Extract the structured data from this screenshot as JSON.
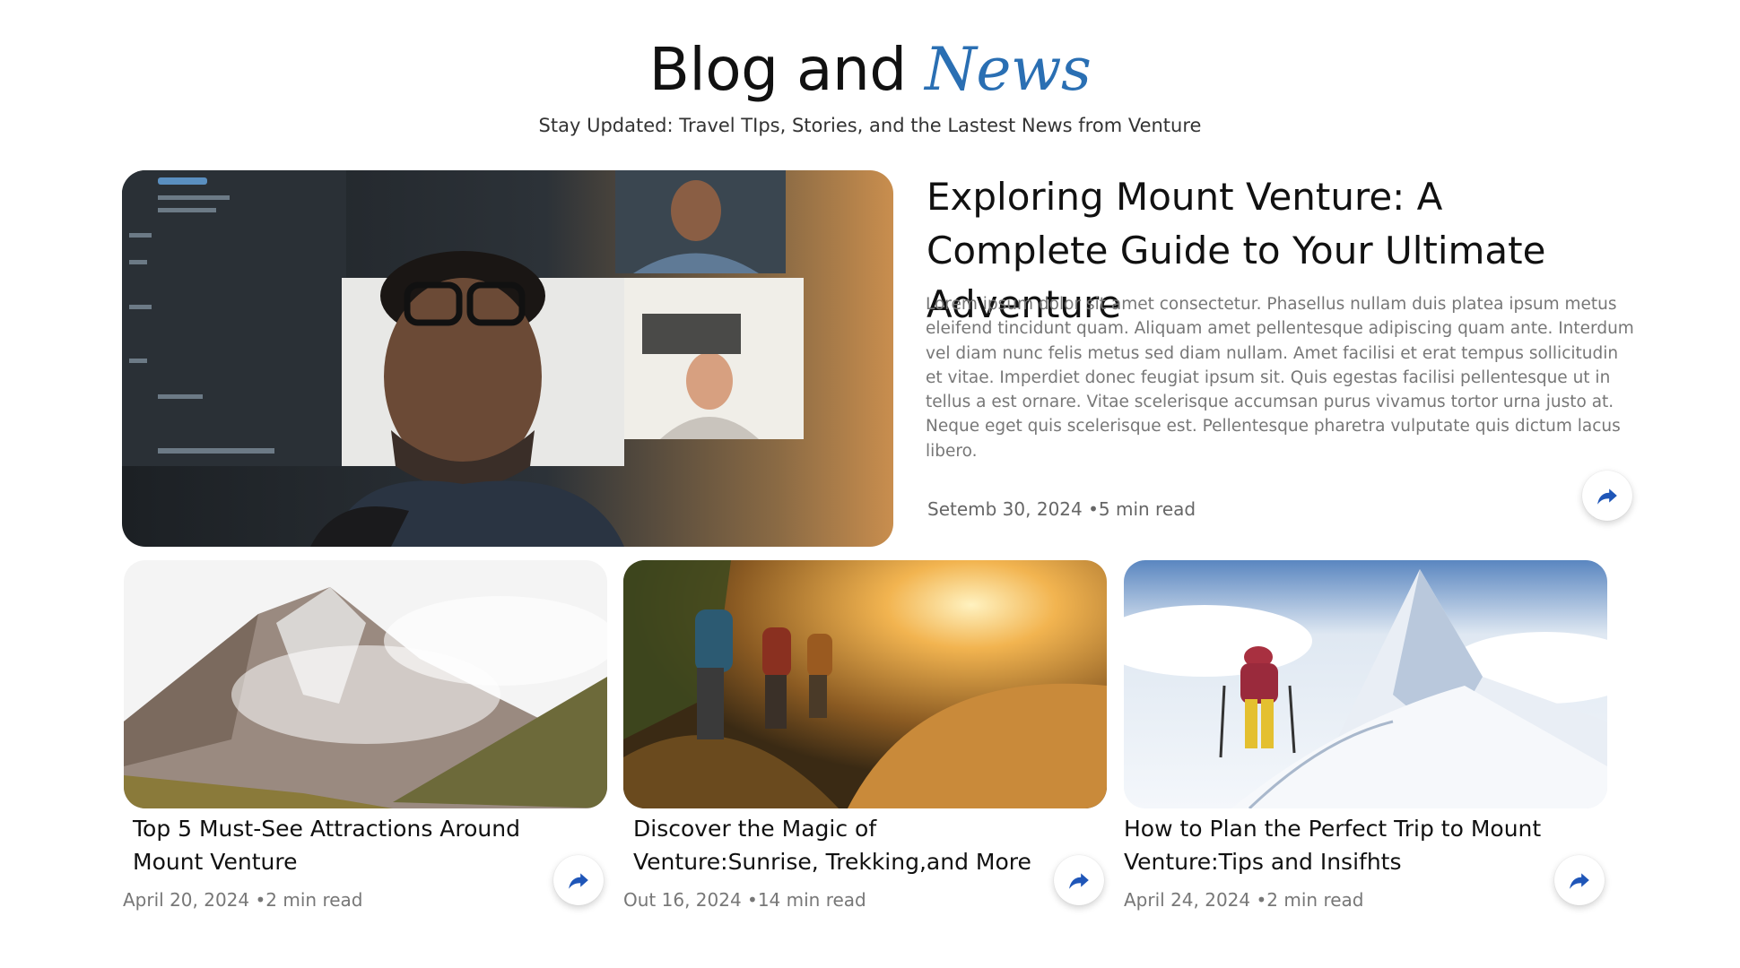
{
  "header": {
    "title_main": "Blog and",
    "title_accent": "News",
    "subtitle": "Stay Updated: Travel TIps, Stories, and the Lastest News from Venture"
  },
  "featured": {
    "title": "Exploring Mount Venture: A Complete Guide to Your Ultimate Adventure",
    "body": "Lorem ipsum dolor sit amet consectetur. Phasellus nullam duis platea ipsum metus eleifend tincidunt quam. Aliquam amet pellentesque adipiscing quam ante. Interdum vel diam nunc felis metus sed diam nullam. Amet facilisi et erat tempus sollicitudin et vitae. Imperdiet donec feugiat ipsum sit. Quis egestas facilisi pellentesque ut in tellus a est ornare. Vitae scelerisque accumsan purus vivamus tortor urna justo at. Neque eget quis scelerisque est. Pellentesque pharetra vulputate quis dictum lacus libero.",
    "meta": "Setemb 30, 2024 •5 min read",
    "image_icon": "video-call-photo",
    "share_icon": "share-icon"
  },
  "cards": [
    {
      "title": "Top 5 Must-See Attractions Around Mount Venture",
      "meta": "April 20, 2024 •2 min read",
      "image_icon": "misty-mountain-photo"
    },
    {
      "title": "Discover the Magic of Venture:Sunrise, Trekking,and More",
      "meta": "Out 16, 2024 •14 min read",
      "image_icon": "hikers-sunset-photo"
    },
    {
      "title": "How to Plan the Perfect Trip to Mount Venture:Tips and Insifhts",
      "meta": "April 24, 2024 •2 min read",
      "image_icon": "snow-summit-climber-photo"
    }
  ],
  "colors": {
    "accent": "#2a6fb3",
    "share_icon": "#1f56b8"
  }
}
